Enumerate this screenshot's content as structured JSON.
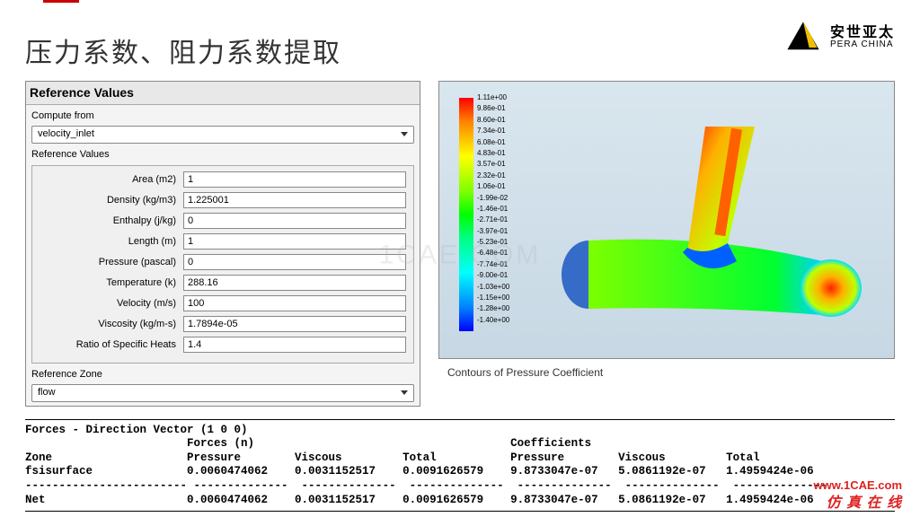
{
  "header": {
    "title": "压力系数、阻力系数提取"
  },
  "logo": {
    "cn": "安世亚太",
    "en": "PERA CHINA"
  },
  "panel": {
    "title": "Reference Values",
    "compute_from_label": "Compute from",
    "compute_from_value": "velocity_inlet",
    "ref_values_label": "Reference Values",
    "fields": [
      {
        "label": "Area (m2)",
        "value": "1"
      },
      {
        "label": "Density (kg/m3)",
        "value": "1.225001"
      },
      {
        "label": "Enthalpy (j/kg)",
        "value": "0"
      },
      {
        "label": "Length (m)",
        "value": "1"
      },
      {
        "label": "Pressure (pascal)",
        "value": "0"
      },
      {
        "label": "Temperature (k)",
        "value": "288.16"
      },
      {
        "label": "Velocity (m/s)",
        "value": "100"
      },
      {
        "label": "Viscosity (kg/m-s)",
        "value": "1.7894e-05"
      },
      {
        "label": "Ratio of Specific Heats",
        "value": "1.4"
      }
    ],
    "ref_zone_label": "Reference Zone",
    "ref_zone_value": "flow"
  },
  "viz": {
    "ticks": [
      "1.11e+00",
      "9.86e-01",
      "8.60e-01",
      "7.34e-01",
      "6.08e-01",
      "4.83e-01",
      "3.57e-01",
      "2.32e-01",
      "1.06e-01",
      "-1.99e-02",
      "-1.46e-01",
      "-2.71e-01",
      "-3.97e-01",
      "-5.23e-01",
      "-6.48e-01",
      "-7.74e-01",
      "-9.00e-01",
      "-1.03e+00",
      "-1.15e+00",
      "-1.28e+00",
      "-1.40e+00"
    ],
    "caption": "Contours of Pressure Coefficient"
  },
  "forces": {
    "heading": "Forces - Direction Vector (1 0 0)",
    "h_forces": "Forces (n)",
    "h_coeffs": "Coefficients",
    "col_zone": "Zone",
    "col_pressure": "Pressure",
    "col_viscous": "Viscous",
    "col_total": "Total",
    "row_zone": "fsisurface",
    "row_p": "0.0060474062",
    "row_v": "0.0031152517",
    "row_t": "0.0091626579",
    "row_cp": "9.8733047e-07",
    "row_cv": "5.0861192e-07",
    "row_ct": "1.4959424e-06",
    "net_label": "Net",
    "net_p": "0.0060474062",
    "net_v": "0.0031152517",
    "net_t": "0.0091626579",
    "net_cp": "9.8733047e-07",
    "net_cv": "5.0861192e-07",
    "net_ct": "1.4959424e-06"
  },
  "footer": {
    "brand": "仿 真 在 线",
    "url": "www.1CAE.com"
  },
  "watermark": "1CAE.COM"
}
